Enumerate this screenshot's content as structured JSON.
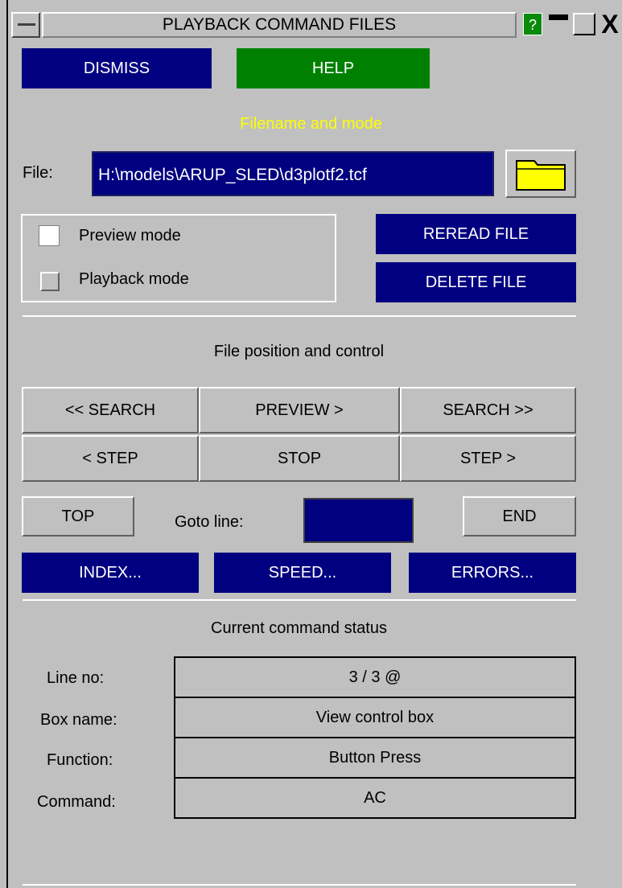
{
  "window": {
    "title": "PLAYBACK COMMAND FILES",
    "help_glyph": "?",
    "close_glyph": "X"
  },
  "top_buttons": {
    "dismiss": "DISMISS",
    "help": "HELP"
  },
  "file_section": {
    "heading": "Filename and mode",
    "file_label": "File:",
    "file_value": "H:\\models\\ARUP_SLED\\d3plotf2.tcf",
    "folder_icon": "folder-icon",
    "preview_mode_label": "Preview mode",
    "preview_mode_checked": false,
    "playback_mode_label": "Playback mode",
    "playback_mode_checked": false,
    "reread_file": "REREAD FILE",
    "delete_file": "DELETE FILE"
  },
  "control_section": {
    "heading": "File position and control",
    "search_back": "<< SEARCH",
    "preview": "PREVIEW >",
    "search_forward": "SEARCH >>",
    "step_back": "< STEP",
    "stop": "STOP",
    "step_forward": "STEP >",
    "top": "TOP",
    "goto_label": "Goto line:",
    "goto_value": "",
    "end": "END",
    "index": "INDEX...",
    "speed": "SPEED...",
    "errors": "ERRORS..."
  },
  "status_section": {
    "heading": "Current command status",
    "rows": [
      {
        "label": "Line no:",
        "value": "3 /    3 @"
      },
      {
        "label": "Box name:",
        "value": "View control box"
      },
      {
        "label": "Function:",
        "value": "Button Press"
      },
      {
        "label": "Command:",
        "value": "AC"
      }
    ]
  },
  "colors": {
    "panel": "#c0c0c0",
    "action_blue": "#000080",
    "help_green": "#008000",
    "heading_yellow": "#ffff00",
    "folder_yellow": "#ffff00"
  }
}
